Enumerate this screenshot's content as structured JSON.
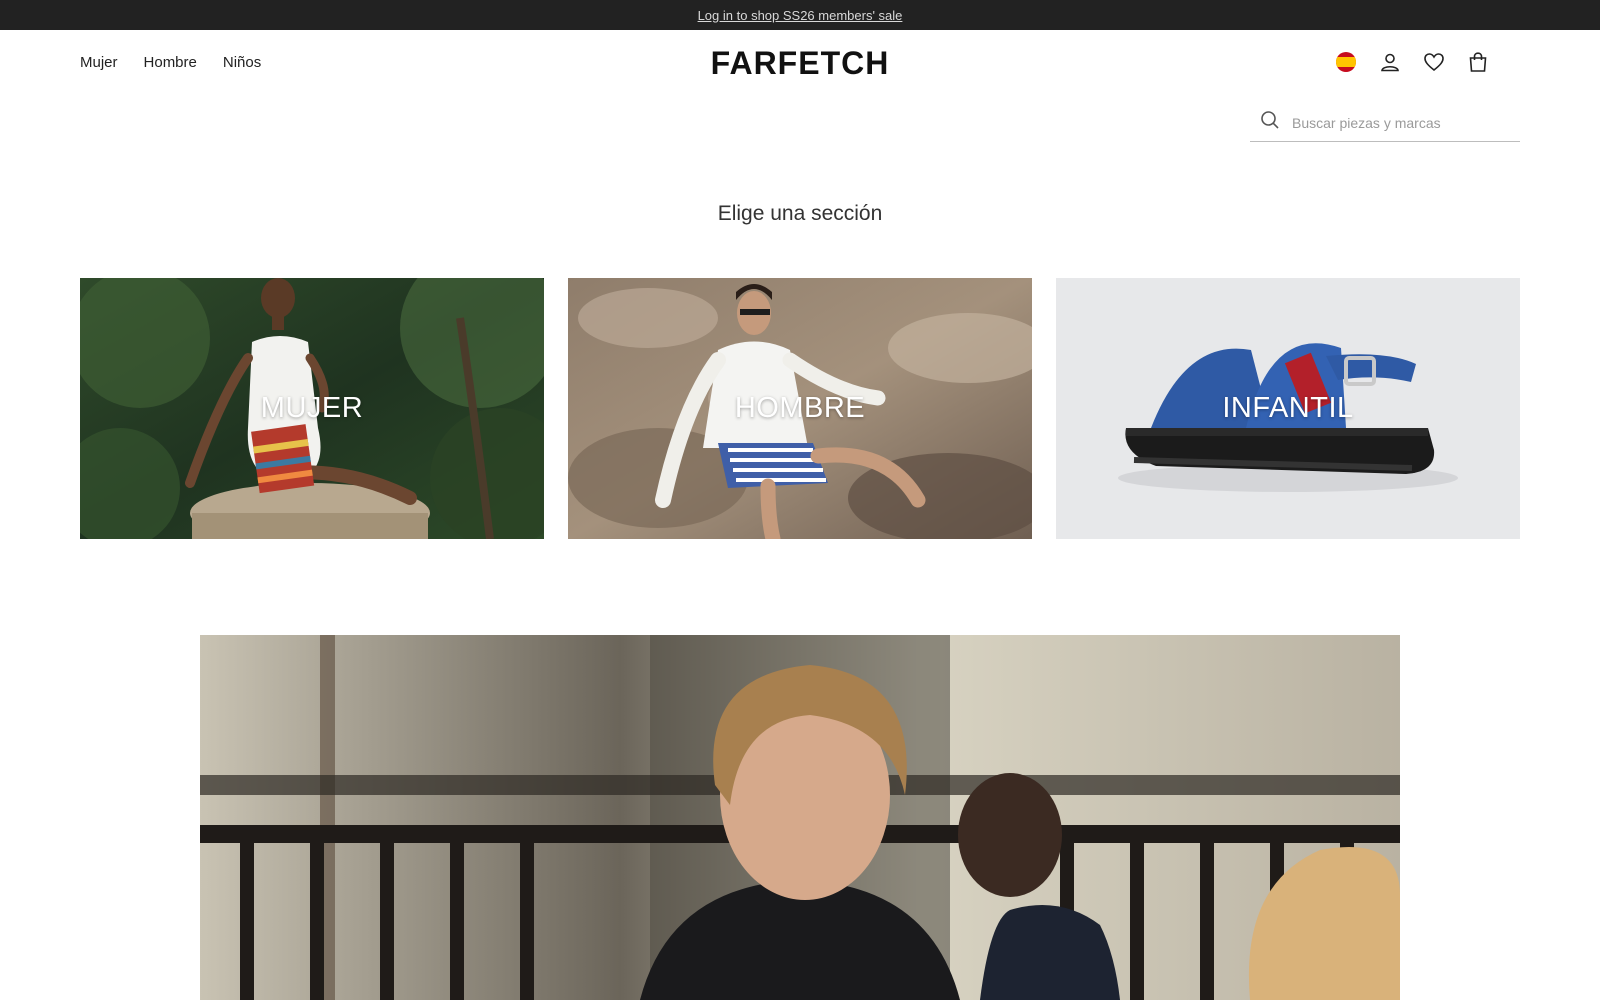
{
  "announcement": {
    "text": "Log in to shop SS26 members' sale"
  },
  "header": {
    "nav": [
      {
        "label": "Mujer"
      },
      {
        "label": "Hombre"
      },
      {
        "label": "Niños"
      }
    ],
    "logo": "FARFETCH",
    "icons": [
      "spain-flag-icon",
      "user-icon",
      "heart-icon",
      "bag-icon"
    ]
  },
  "search": {
    "placeholder": "Buscar piezas y marcas",
    "icon": "search-icon"
  },
  "section": {
    "title": "Elige una sección"
  },
  "tiles": [
    {
      "label": "MUJER"
    },
    {
      "label": "HOMBRE"
    },
    {
      "label": "INFANTIL"
    }
  ],
  "colors": {
    "topbar": "#222222",
    "text": "#222222",
    "accent_red": "#c60b1e",
    "accent_yellow": "#ffc400"
  }
}
